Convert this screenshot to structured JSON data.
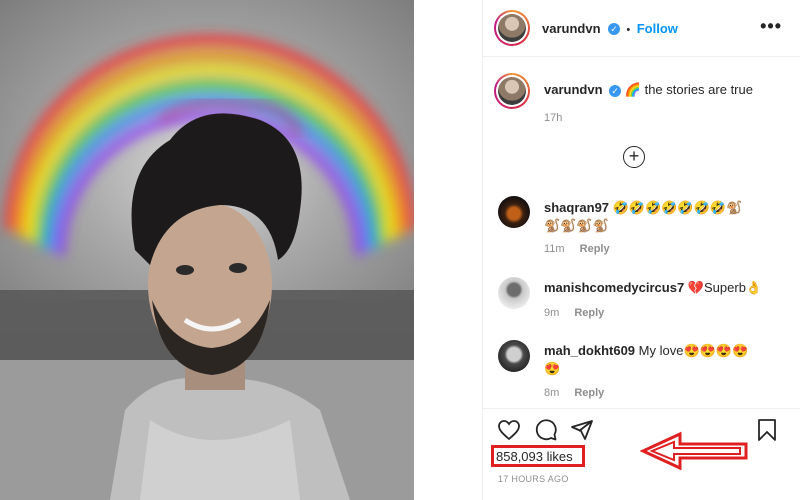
{
  "post": {
    "username": "varundvn",
    "follow_label": "Follow",
    "separator": "•",
    "more_label": "•••",
    "caption_emoji": "🌈",
    "caption_text": "the stories are true",
    "caption_time": "17h",
    "likes": "858,093 likes",
    "posted": "17 HOURS AGO"
  },
  "comments": [
    {
      "username": "shaqran97",
      "text": "🤣🤣🤣🤣🤣🤣🤣🐒",
      "text2": "🐒🐒🐒🐒",
      "time": "11m",
      "reply": "Reply"
    },
    {
      "username": "manishcomedycircus7",
      "text": "💔Superb👌",
      "time": "9m",
      "reply": "Reply"
    },
    {
      "username": "mah_dokht609",
      "text": "My love😍😍😍😍",
      "text2": "😍",
      "time": "8m",
      "reply": "Reply"
    }
  ],
  "icons": {
    "verified": "verified-badge-icon",
    "like": "heart-icon",
    "comment": "comment-icon",
    "share": "share-icon",
    "save": "bookmark-icon",
    "add": "plus-circle-icon",
    "more": "more-options-icon"
  },
  "colors": {
    "accent": "#0095f6",
    "highlight": "#e02020",
    "muted": "#8e8e8e"
  }
}
